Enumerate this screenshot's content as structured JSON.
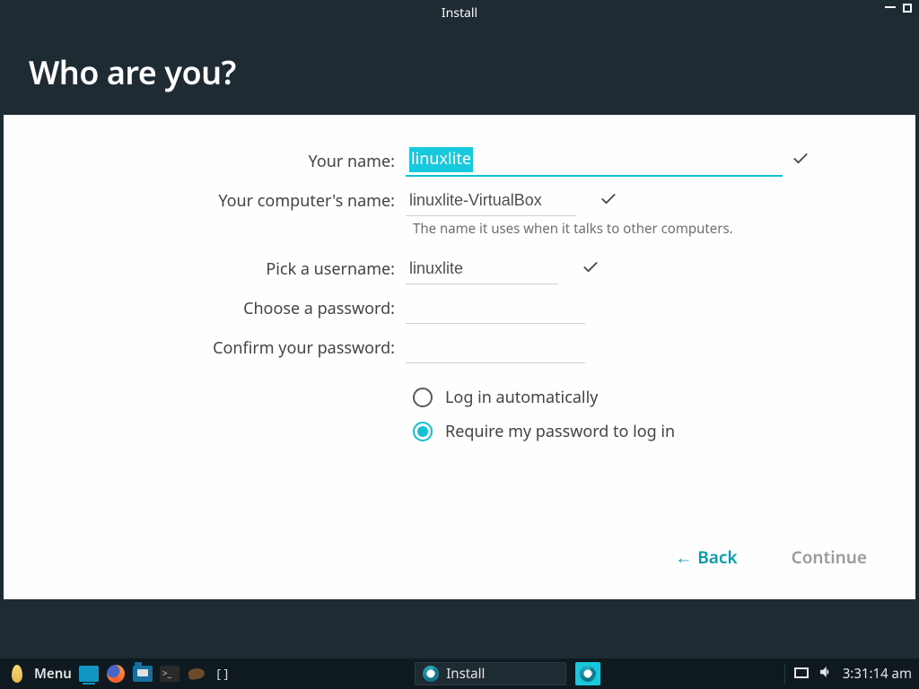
{
  "window": {
    "title": "Install",
    "heading": "Who are you?"
  },
  "form": {
    "name_label": "Your name:",
    "name_value": "linuxlite",
    "hostname_label": "Your computer's name:",
    "hostname_value": "linuxlite-VirtualBox",
    "hostname_hint": "The name it uses when it talks to other computers.",
    "username_label": "Pick a username:",
    "username_value": "linuxlite",
    "password_label": "Choose a password:",
    "password_value": "",
    "confirm_label": "Confirm your password:",
    "confirm_value": ""
  },
  "login_options": {
    "auto": "Log in automatically",
    "require": "Require my password to log in",
    "selected": "require"
  },
  "buttons": {
    "back": "Back",
    "continue": "Continue"
  },
  "taskbar": {
    "menu": "Menu",
    "active_app": "Install",
    "clock": "3:31:14 am"
  }
}
